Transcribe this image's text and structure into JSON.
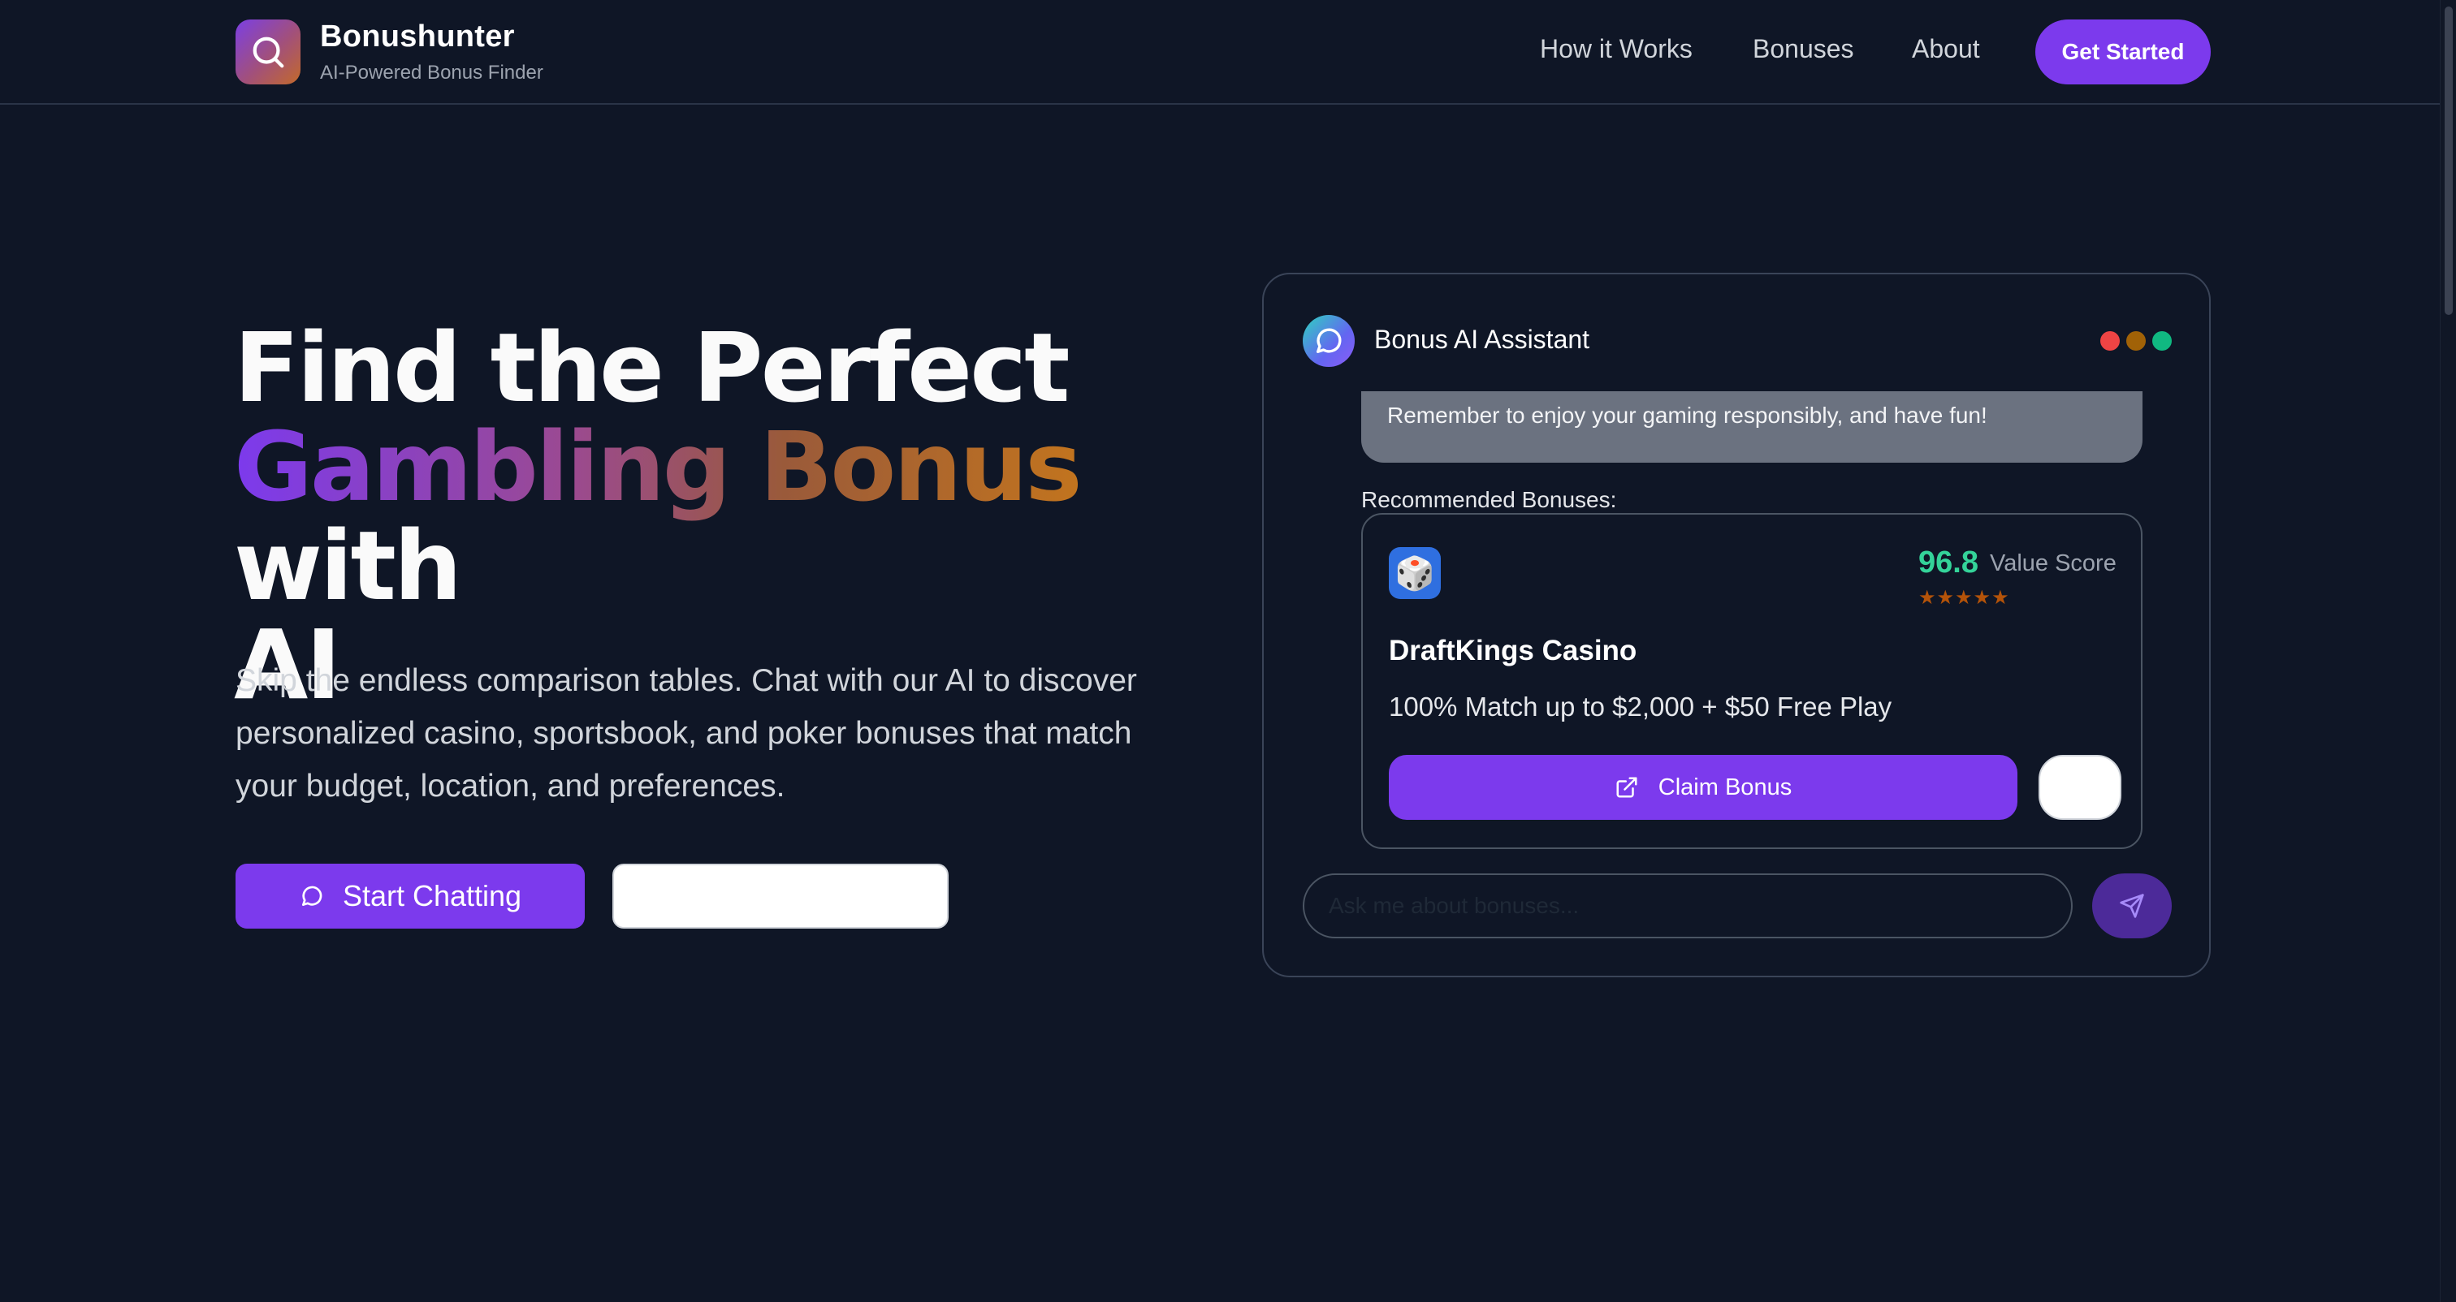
{
  "header": {
    "brand_title": "Bonushunter",
    "brand_subtitle": "AI-Powered Bonus Finder",
    "logo_icon": "search-icon",
    "nav": {
      "how_it_works": "How it Works",
      "bonuses": "Bonuses",
      "about": "About"
    },
    "cta_label": "Get Started"
  },
  "hero": {
    "title_line1": "Find the Perfect",
    "title_highlight": "Gambling Bonus",
    "title_with": "with",
    "title_line3": "AI",
    "description": "Skip the endless comparison tables. Chat with our AI to discover personalized casino, sportsbook, and poker bonuses that match your budget, location, and preferences.",
    "primary_button": "Start Chatting",
    "primary_button_icon": "chat-bubble-icon",
    "secondary_button": ""
  },
  "chat": {
    "title": "Bonus AI Assistant",
    "avatar_icon": "chat-bubble-icon",
    "message_text": "Remember to enjoy your gaming responsibly, and have fun!",
    "recommended_label": "Recommended Bonuses:",
    "bonus": {
      "icon": "dice-icon",
      "icon_glyph": "🎲",
      "score": "96.8",
      "score_label": "Value Score",
      "rating_stars": 5,
      "name": "DraftKings Casino",
      "offer": "100% Match up to $2,000 + $50 Free Play",
      "claim_label": "Claim Bonus",
      "claim_icon": "external-link-icon"
    },
    "input_placeholder": "Ask me about bonuses...",
    "send_icon": "send-icon"
  },
  "colors": {
    "background": "#0f1626",
    "accent": "#7c3aed",
    "score_green": "#34d399",
    "star_amber": "#b45309",
    "window_dot_red": "#ef4444",
    "window_dot_amber": "#a16207",
    "window_dot_green": "#10b981"
  }
}
